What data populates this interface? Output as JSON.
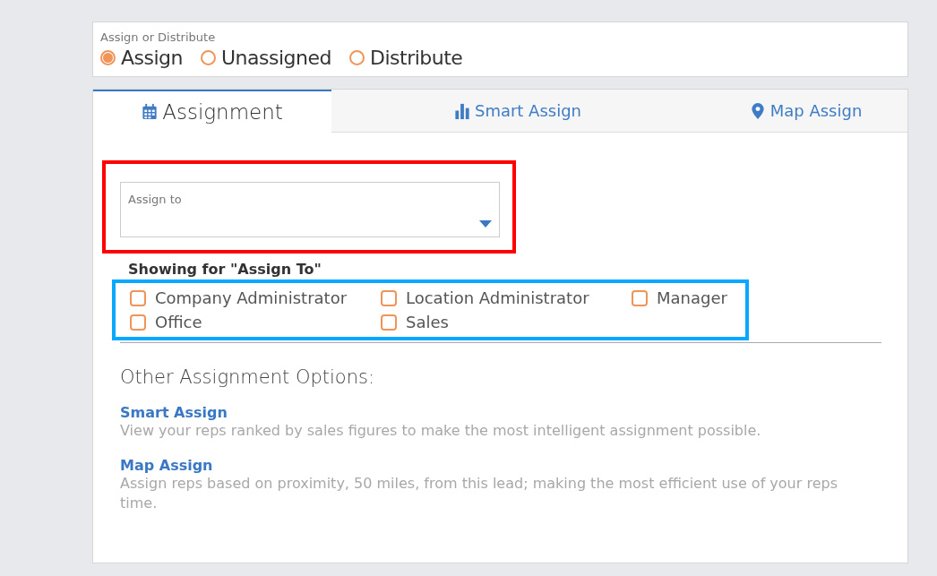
{
  "mode": {
    "label": "Assign or Distribute",
    "options": [
      {
        "label": "Assign",
        "selected": true
      },
      {
        "label": "Unassigned",
        "selected": false
      },
      {
        "label": "Distribute",
        "selected": false
      }
    ]
  },
  "tabs": [
    {
      "label": "Assignment",
      "kind": "calendar",
      "selected": true
    },
    {
      "label": "Smart Assign",
      "kind": "bars",
      "selected": false
    },
    {
      "label": "Map Assign",
      "kind": "pin",
      "selected": false
    }
  ],
  "assign_to": {
    "label": "Assign to"
  },
  "showing_heading": "Showing for \"Assign To\"",
  "roles": [
    {
      "label": "Company Administrator",
      "checked": false
    },
    {
      "label": "Location Administrator",
      "checked": false
    },
    {
      "label": "Manager",
      "checked": false
    },
    {
      "label": "Office",
      "checked": false
    },
    {
      "label": "Sales",
      "checked": false
    }
  ],
  "other_options": {
    "title": "Other Assignment Options:",
    "items": [
      {
        "title": "Smart Assign",
        "description": "View your reps ranked by sales figures to make the most intelligent assignment possible."
      },
      {
        "title": "Map Assign",
        "description": "Assign reps based on proximity, 50 miles, from this lead; making the most efficient use of your reps time."
      }
    ]
  }
}
